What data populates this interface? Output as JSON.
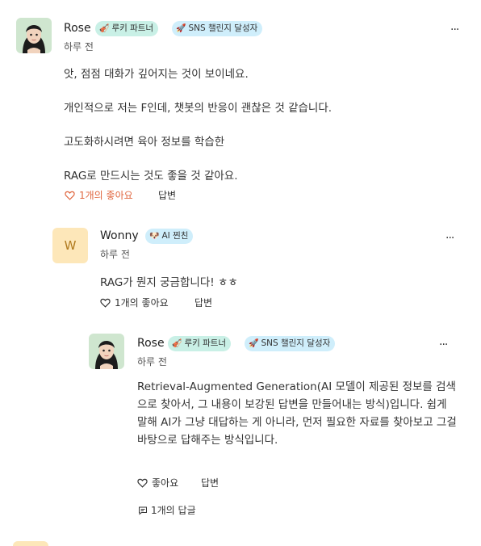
{
  "comment1": {
    "author": "Rose",
    "badge1": "루키 파트너",
    "badge1_icon": "violin-icon",
    "badge2": "SNS 챌린지 달성자",
    "badge2_icon": "rocket-icon",
    "time": "하루 전",
    "more": "···",
    "lines": [
      "앗, 점점 대화가 깊어지는 것이 보이네요.",
      "개인적으로 저는 F인데, 챗봇의 반응이 괜찮은 것 같습니다.",
      "고도화하시려면 육아 정보를 학습한",
      "RAG로 만드시는 것도 좋을 것 같아요."
    ],
    "like_label": "1개의 좋아요",
    "reply_label": "답변"
  },
  "comment2": {
    "avatar_letter": "W",
    "author": "Wonny",
    "badge1": "AI 찐친",
    "badge1_icon": "dog-icon",
    "time": "하루 전",
    "more": "···",
    "text": "RAG가 뭔지 궁금합니다! ㅎㅎ",
    "like_label": "1개의 좋아요",
    "reply_label": "답변"
  },
  "comment3": {
    "author": "Rose",
    "badge1": "루키 파트너",
    "badge1_icon": "violin-icon",
    "badge2": "SNS 챌린지 달성자",
    "badge2_icon": "rocket-icon",
    "time": "하루 전",
    "more": "···",
    "text": "Retrieval-Augmented Generation(AI 모델이 제공된 정보를 검색으로 찾아서, 그 내용이 보강된 답변을 만들어내는 방식)입니다. 쉽게 말해 AI가 그냥 대답하는 게 아니라, 먼저 필요한 자료를 찾아보고 그걸 바탕으로 답해주는 방식입니다.",
    "like_label": "좋아요",
    "reply_label": "답변",
    "reply_count": "1개의 답글"
  },
  "colors": {
    "like_active": "#e0663f",
    "badge_green": "#c9f0e6",
    "badge_blue": "#cfeefb",
    "avatar_w": "#fde7b9"
  }
}
